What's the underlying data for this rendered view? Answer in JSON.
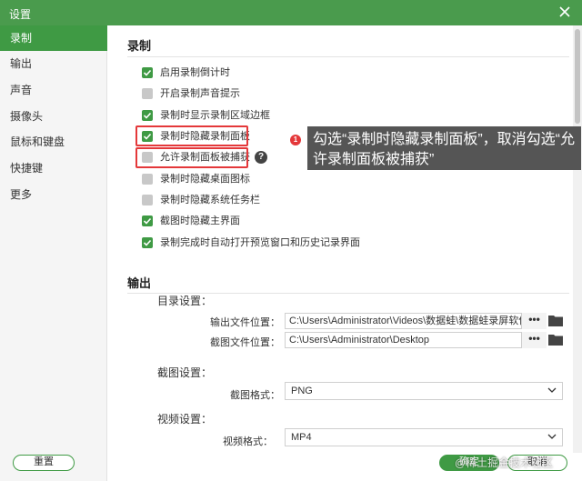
{
  "window": {
    "title": "设置"
  },
  "sidebar": {
    "items": [
      {
        "label": "录制",
        "active": true
      },
      {
        "label": "输出"
      },
      {
        "label": "声音"
      },
      {
        "label": "摄像头"
      },
      {
        "label": "鼠标和键盘"
      },
      {
        "label": "快捷键"
      },
      {
        "label": "更多"
      }
    ]
  },
  "record_section": {
    "title": "录制",
    "options": [
      {
        "label": "启用录制倒计时",
        "checked": true
      },
      {
        "label": "开启录制声音提示",
        "checked": false
      },
      {
        "label": "录制时显示录制区域边框",
        "checked": true
      },
      {
        "label": "录制时隐藏录制面板",
        "checked": true
      },
      {
        "label": "允许录制面板被捕获",
        "checked": false
      },
      {
        "label": "录制时隐藏桌面图标",
        "checked": false
      },
      {
        "label": "录制时隐藏系统任务栏",
        "checked": false
      },
      {
        "label": "截图时隐藏主界面",
        "checked": true
      },
      {
        "label": "录制完成时自动打开预览窗口和历史记录界面",
        "checked": true
      }
    ],
    "help_icon": "?"
  },
  "annotation": {
    "marker": "1",
    "text": "勾选“录制时隐藏录制面板”，取消勾选“允许录制面板被捕获”"
  },
  "output_section": {
    "title": "输出",
    "dir_title": "目录设置：",
    "video_path_label": "输出文件位置：",
    "video_path": "C:\\Users\\Administrator\\Videos\\数据蛙\\数据蛙录屏软件",
    "screenshot_path_label": "截图文件位置：",
    "screenshot_path": "C:\\Users\\Administrator\\Desktop",
    "browse_label": "•••",
    "screenshot_title": "截图设置：",
    "screenshot_format_label": "截图格式：",
    "screenshot_format": "PNG",
    "video_title": "视频设置：",
    "video_format_label": "视频格式：",
    "video_format": "MP4"
  },
  "footer": {
    "reset_label": "重置",
    "ok_label": "确定",
    "cancel_label": "取消",
    "watermark": "@稀土掘金技术社区"
  },
  "colors": {
    "accent": "#3f9a44",
    "highlight": "#e4383a",
    "callout_bg": "#555555"
  }
}
